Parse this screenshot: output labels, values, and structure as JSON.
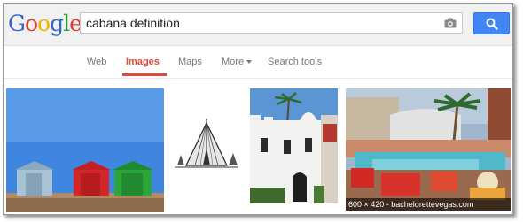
{
  "search": {
    "query": "cabana definition",
    "camera_icon": "camera-icon",
    "button_icon": "magnifier-icon"
  },
  "logo": {
    "letters": [
      "G",
      "o",
      "o",
      "g",
      "l",
      "e"
    ],
    "colors": [
      "#3366cc",
      "#dd3b2f",
      "#f0b400",
      "#3366cc",
      "#2a9c3f",
      "#dd3b2f"
    ]
  },
  "nav": {
    "tabs": [
      {
        "label": "Web"
      },
      {
        "label": "Images",
        "active": true
      },
      {
        "label": "Maps"
      },
      {
        "label": "More"
      },
      {
        "label": "Search tools"
      }
    ]
  },
  "results": {
    "images": [
      {
        "subject": "beach huts"
      },
      {
        "subject": "tent illustration"
      },
      {
        "subject": "white building"
      },
      {
        "subject": "pool with cabanas",
        "caption": "600 × 420 - bachelorettevegas.com"
      }
    ]
  },
  "colors": {
    "accent": "#dd4b39",
    "button": "#4285f4"
  }
}
